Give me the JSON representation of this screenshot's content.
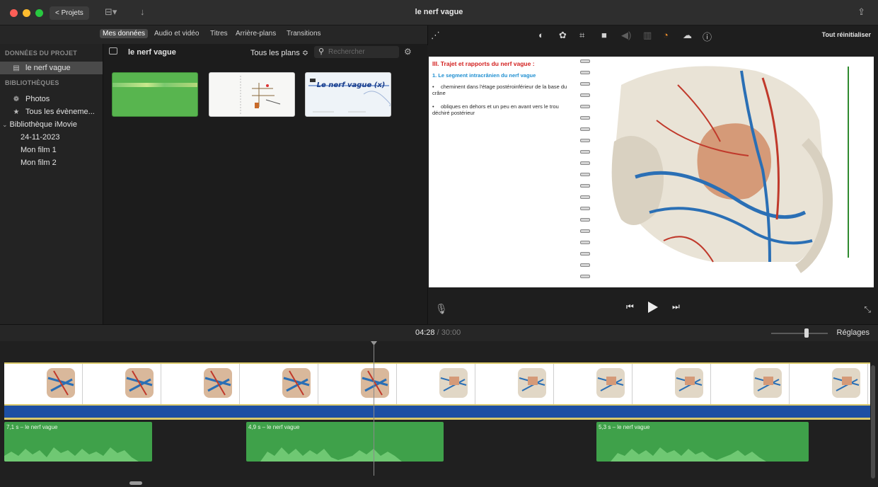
{
  "window": {
    "title": "le nerf vague",
    "projects_label": "< Projets"
  },
  "browser_tabs": [
    {
      "label": "Mes données",
      "active": true
    },
    {
      "label": "Audio et vidéo",
      "active": false
    },
    {
      "label": "Titres",
      "active": false
    },
    {
      "label": "Arrière-plans",
      "active": false
    },
    {
      "label": "Transitions",
      "active": false
    }
  ],
  "sidebar": {
    "project_header": "DONNÉES DU PROJET",
    "project_item": "le nerf vague",
    "libraries_header": "BIBLIOTHÈQUES",
    "photos": "Photos",
    "all_events": "Tous les évèneme...",
    "library_name": "Bibliothèque iMovie",
    "events": [
      "24-11-2023",
      "Mon film 1",
      "Mon film 2"
    ]
  },
  "browser": {
    "title": "le nerf vague",
    "filter": "Tous les plans ≎",
    "search_placeholder": "Rechercher",
    "clip3_title": "Le nerf vague (x)"
  },
  "viewer": {
    "reset_label": "Tout réinitialiser",
    "slide_title": "III. Trajet et rapports du nerf vague :",
    "slide_subtitle": "1. Le segment intracrânien du nerf vague",
    "bullets": [
      "cheminent dans l'étage postéroinférieur de la base du crâne",
      "obliques en dehors et un peu en avant vers le trou déchiré postérieur"
    ]
  },
  "timeline": {
    "current_time": "04:28",
    "total_time": "/ 30:00",
    "settings_label": "Réglages",
    "audio_clips": [
      {
        "label": "7,1 s – le nerf vague"
      },
      {
        "label": "4,9 s – le nerf vague"
      },
      {
        "label": "5,3 s – le nerf vague"
      }
    ]
  },
  "colors": {
    "audio_clip": "#3fa14a",
    "video_blue": "#1d4fa3",
    "accent_gold": "#d9c86a",
    "slide_red": "#d3201f",
    "slide_blue": "#1f8fd1"
  }
}
